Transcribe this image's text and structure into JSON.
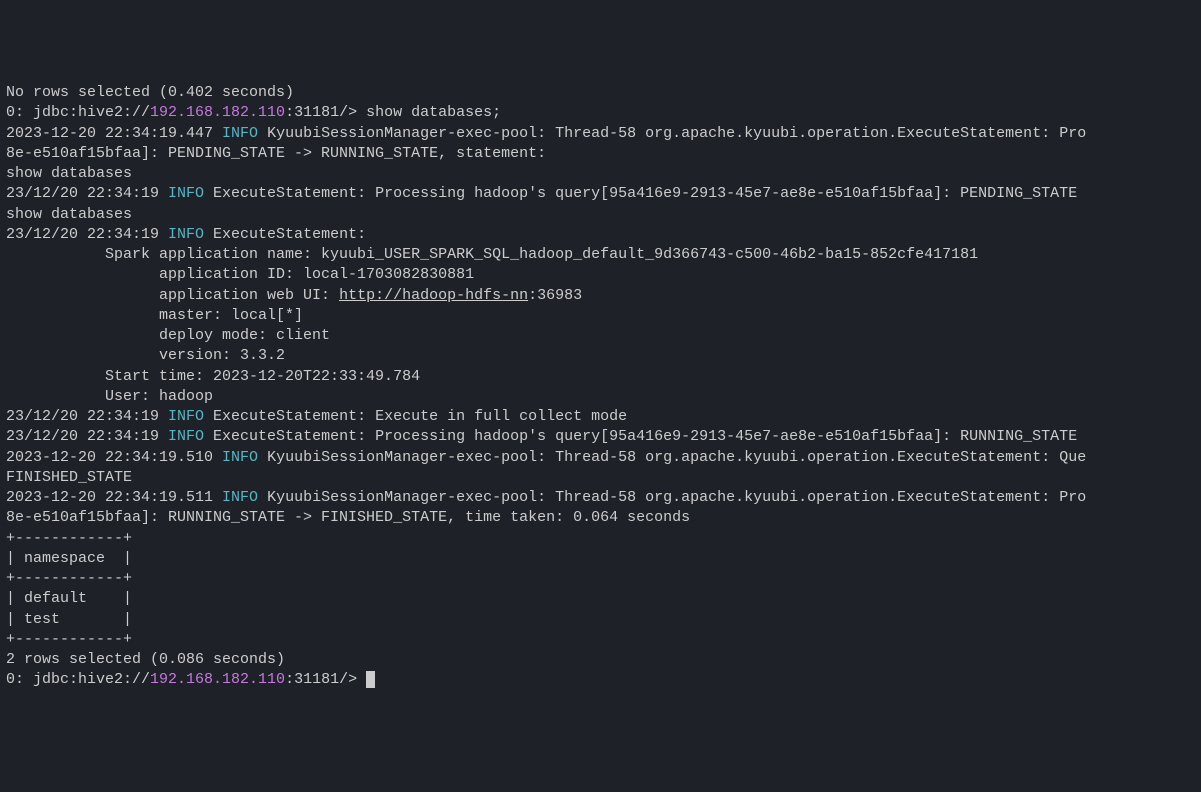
{
  "lines": {
    "l1": "No rows selected (0.402 seconds)",
    "l2_prefix": "0: jdbc:hive2://",
    "l2_host": "192.168.182.110",
    "l2_suffix": ":31181/> show databases;",
    "l3_ts": "2023-12-20 22:34:19.447 ",
    "l3_info": "INFO",
    "l3_rest": " KyuubiSessionManager-exec-pool: Thread-58 org.apache.kyuubi.operation.ExecuteStatement: Pro",
    "l4": "8e-e510af15bfaa]: PENDING_STATE -> RUNNING_STATE, statement:",
    "l5": "show databases",
    "l6_ts": "23/12/20 22:34:19 ",
    "l6_info": "INFO",
    "l6_rest": " ExecuteStatement: Processing hadoop's query[95a416e9-2913-45e7-ae8e-e510af15bfaa]: PENDING_STATE ",
    "l7": "show databases",
    "l8_ts": "23/12/20 22:34:19 ",
    "l8_info": "INFO",
    "l8_rest": " ExecuteStatement:",
    "l9": "           Spark application name: kyuubi_USER_SPARK_SQL_hadoop_default_9d366743-c500-46b2-ba15-852cfe417181",
    "l10": "                 application ID: local-1703082830881",
    "l11_pre": "                 application web UI: ",
    "l11_url": "http://hadoop-hdfs-nn",
    "l11_post": ":36983",
    "l12": "                 master: local[*]",
    "l13": "                 deploy mode: client",
    "l14": "                 version: 3.3.2",
    "l15": "           Start time: 2023-12-20T22:33:49.784",
    "l16": "           User: hadoop",
    "l17_ts": "23/12/20 22:34:19 ",
    "l17_info": "INFO",
    "l17_rest": " ExecuteStatement: Execute in full collect mode",
    "l18_ts": "23/12/20 22:34:19 ",
    "l18_info": "INFO",
    "l18_rest": " ExecuteStatement: Processing hadoop's query[95a416e9-2913-45e7-ae8e-e510af15bfaa]: RUNNING_STATE ",
    "l19_ts": "2023-12-20 22:34:19.510 ",
    "l19_info": "INFO",
    "l19_rest": " KyuubiSessionManager-exec-pool: Thread-58 org.apache.kyuubi.operation.ExecuteStatement: Que",
    "l20": "FINISHED_STATE",
    "l21_ts": "2023-12-20 22:34:19.511 ",
    "l21_info": "INFO",
    "l21_rest": " KyuubiSessionManager-exec-pool: Thread-58 org.apache.kyuubi.operation.ExecuteStatement: Pro",
    "l22": "8e-e510af15bfaa]: RUNNING_STATE -> FINISHED_STATE, time taken: 0.064 seconds",
    "t1": "+------------+",
    "t2": "| namespace  |",
    "t3": "+------------+",
    "t4": "| default    |",
    "t5": "| test       |",
    "t6": "+------------+",
    "l29": "2 rows selected (0.086 seconds)",
    "l30_prefix": "0: jdbc:hive2://",
    "l30_host": "192.168.182.110",
    "l30_suffix": ":31181/> "
  }
}
